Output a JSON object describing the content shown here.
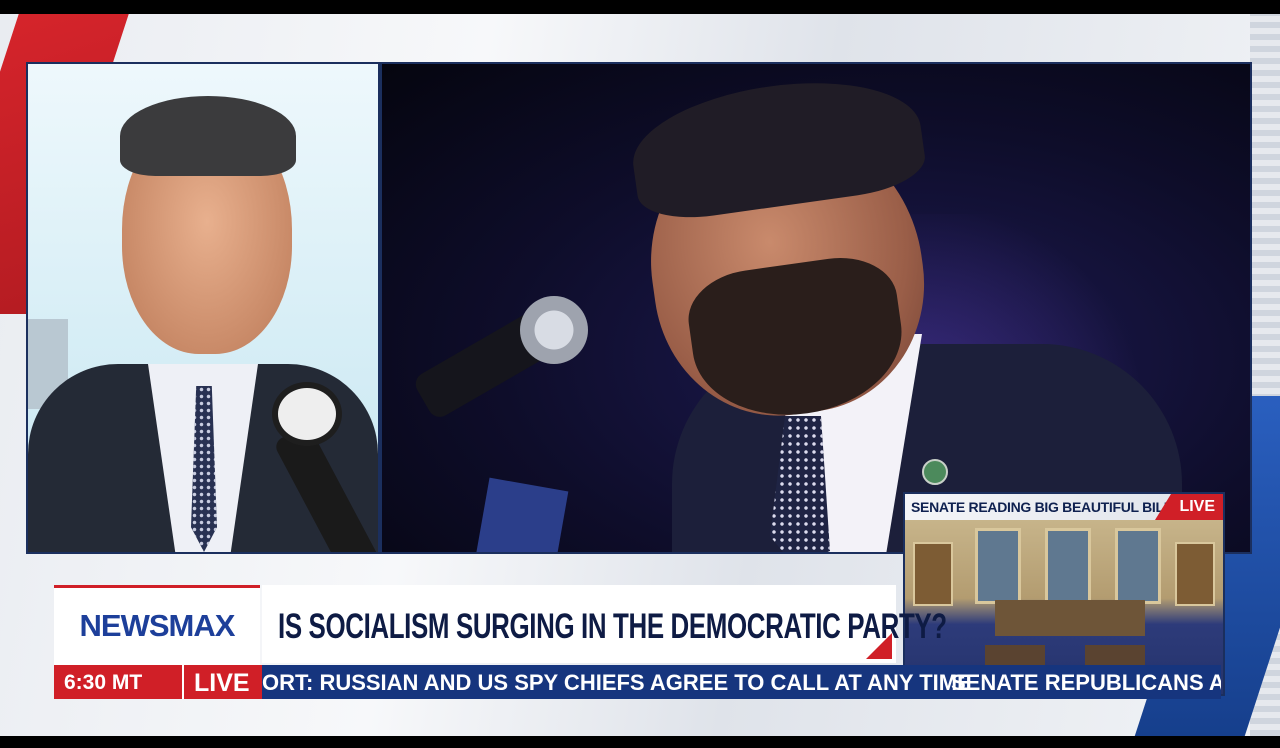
{
  "mini_live": {
    "title": "SENATE READING BIG BEAUTIFUL BILL",
    "live": "LIVE"
  },
  "lower_third": {
    "logo": "NEWSMAX",
    "headline": "IS SOCIALISM SURGING IN THE DEMOCRATIC PARTY?",
    "time": "6:30 MT",
    "live": "LIVE"
  },
  "ticker": {
    "left": "ORT: RUSSIAN AND US SPY CHIEFS AGREE TO CALL AT ANY TIME",
    "right": "SENATE REPUBLICANS ADV"
  },
  "colors": {
    "brand_blue": "#1d3f9a",
    "live_red": "#d01f27",
    "ticker_blue": "#16357e"
  }
}
